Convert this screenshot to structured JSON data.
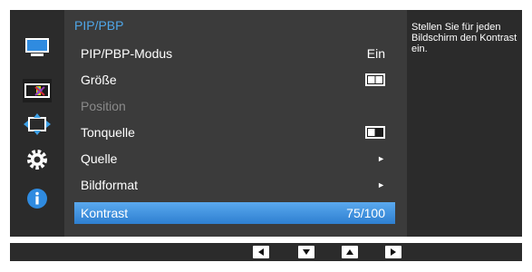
{
  "menu": {
    "title": "PIP/PBP",
    "items": [
      {
        "label": "PIP/PBP-Modus",
        "value": "Ein"
      },
      {
        "label": "Größe",
        "value_icon": "pbp-split-icon"
      },
      {
        "label": "Position"
      },
      {
        "label": "Tonquelle",
        "value_icon": "left-screen-icon"
      },
      {
        "label": "Quelle",
        "value_icon": "chevron-right-icon"
      },
      {
        "label": "Bildformat",
        "value_icon": "chevron-right-icon"
      },
      {
        "label": "Kontrast",
        "value": "75/100"
      }
    ]
  },
  "description": "Stellen Sie für jeden Bildschirm den Kontrast ein.",
  "sidebar": {
    "icons": [
      "picture-icon",
      "color-icon",
      "size-position-icon",
      "setup-icon",
      "information-icon"
    ],
    "selected": "color-icon"
  },
  "navbar": {
    "buttons": [
      "left-arrow-icon",
      "down-arrow-icon",
      "up-arrow-icon",
      "right-arrow-icon"
    ]
  },
  "colors": {
    "menu_title": "#4fa6e8",
    "highlight": "#3d93e0",
    "disabled_text": "#8a8a8a"
  }
}
